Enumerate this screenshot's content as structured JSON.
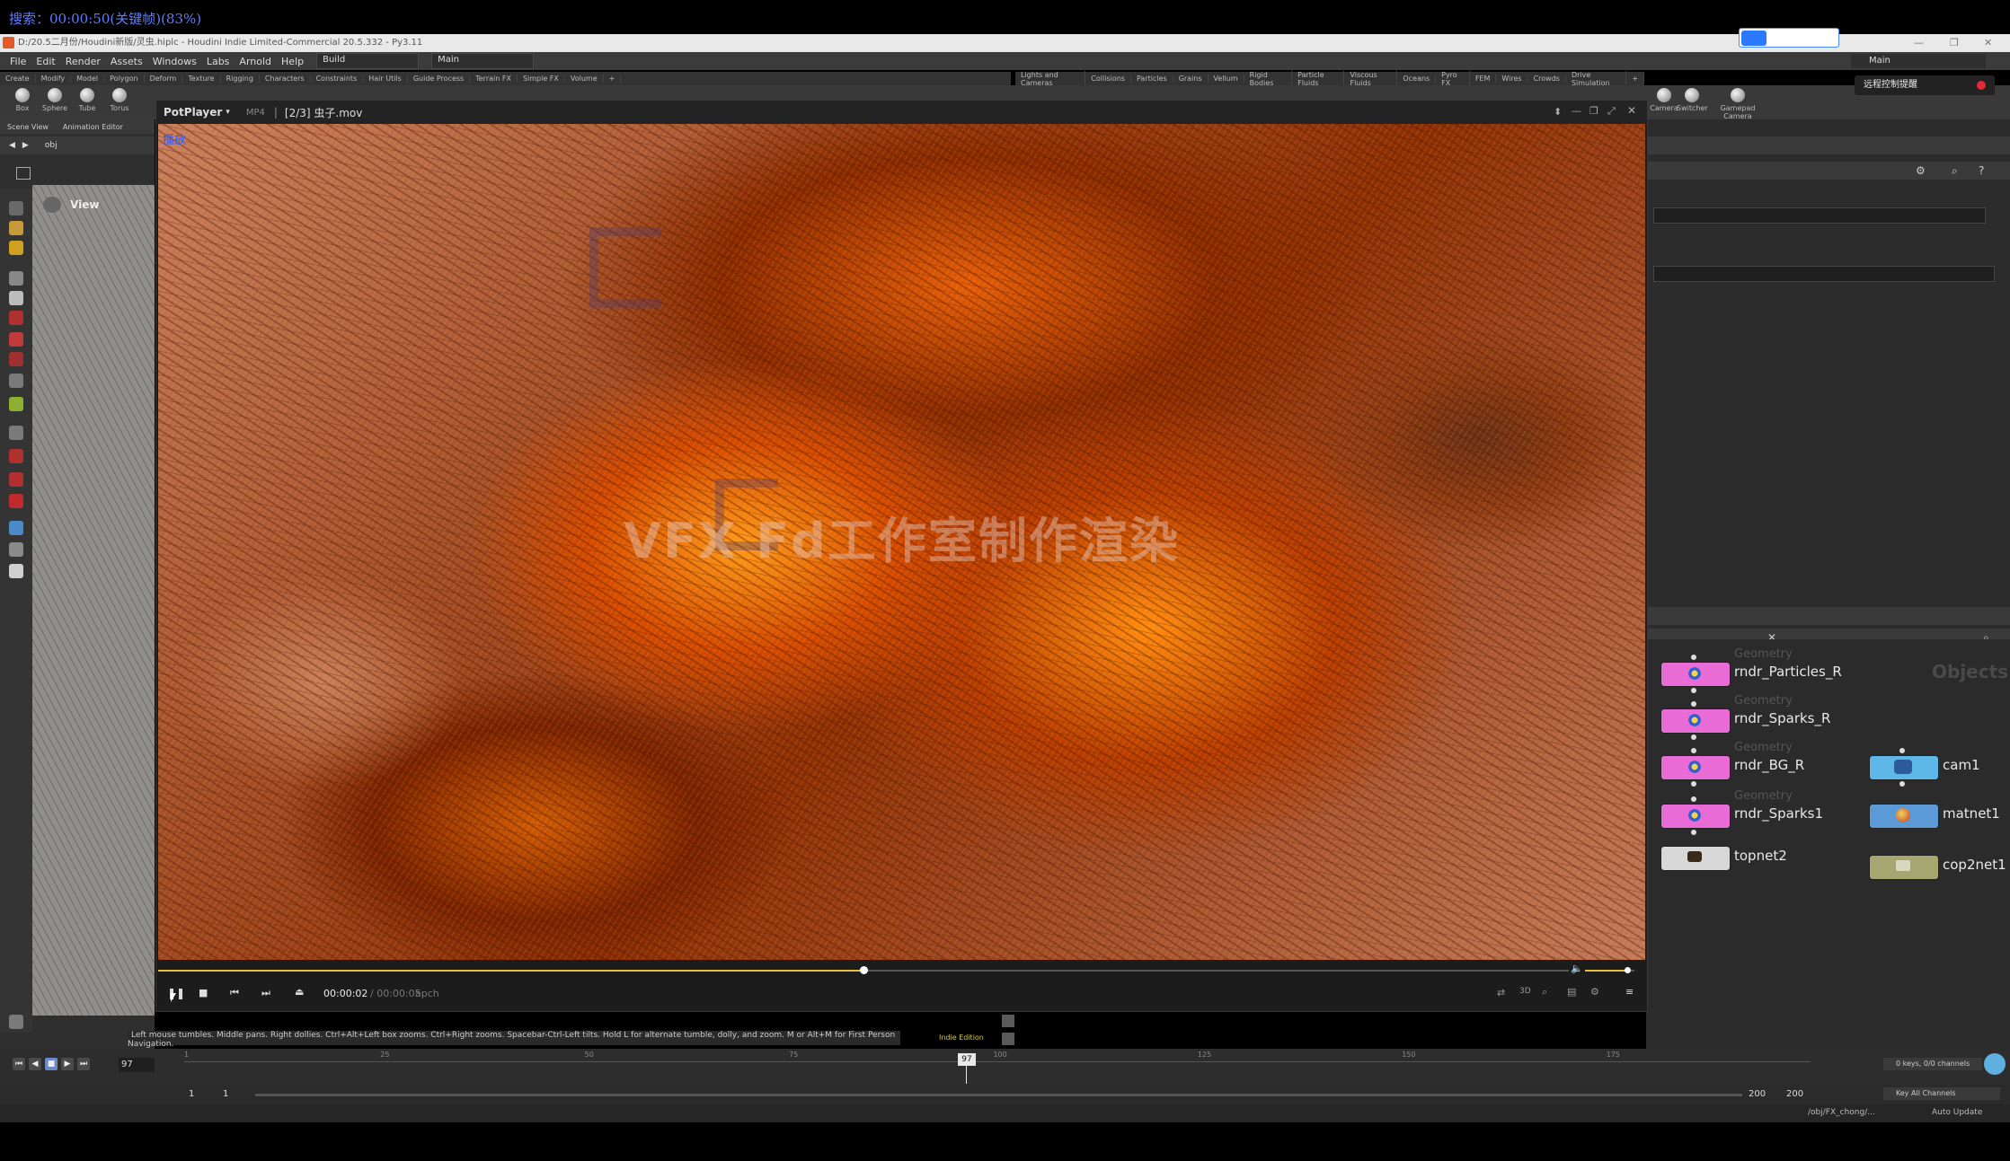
{
  "overlay": {
    "search_text": "搜索：00:00:50(关键帧)(83%)"
  },
  "houdini": {
    "title": "D:/20.5二月份/Houdini新版/灵虫.hiplc - Houdini Indie Limited-Commercial 20.5.332 - Py3.11",
    "menu": [
      "File",
      "Edit",
      "Render",
      "Assets",
      "Windows",
      "Labs",
      "Arnold",
      "Help"
    ],
    "build_dropdown": "Build",
    "main_dropdown": "Main",
    "main_dropdown_right": "Main",
    "remote_chip": "远程控制提醒",
    "shelf_tabs_left": [
      "Create",
      "Modify",
      "Model",
      "Polygon",
      "Deform",
      "Texture",
      "Rigging",
      "Characters",
      "Constraints",
      "Hair Utils",
      "Guide Process",
      "Terrain FX",
      "Simple FX",
      "Volume"
    ],
    "shelf_tabs_right": [
      "Lights and Cameras",
      "Collisions",
      "Particles",
      "Grains",
      "Vellum",
      "Rigid Bodies",
      "Particle Fluids",
      "Viscous Fluids",
      "Oceans",
      "Pyro FX",
      "FEM",
      "Wires",
      "Crowds",
      "Drive Simulation"
    ],
    "shelf_tools": [
      "Box",
      "Sphere",
      "Tube",
      "Torus"
    ],
    "shelf_tools_right": [
      "Camera",
      "Switcher",
      "Gamepad Camera"
    ],
    "left_tabs": [
      "Scene View",
      "Animation Editor"
    ],
    "left_path": "obj",
    "view_label": "View",
    "hint": "Left mouse tumbles. Middle pans. Right dollies. Ctrl+Alt+Left box zooms. Ctrl+Right zooms. Spacebar-Ctrl-Left tilts. Hold L for alternate tumble, dolly, and zoom. M or Alt+M for First Person Navigation.",
    "indie_label": "Indie Edition",
    "network_label": "Objects",
    "nodes": [
      {
        "type": "Geometry",
        "name": "rndr_Particles_R",
        "color": "#e86bd6"
      },
      {
        "type": "Geometry",
        "name": "rndr_Sparks_R",
        "color": "#e86bd6"
      },
      {
        "type": "Geometry",
        "name": "rndr_BG_R",
        "color": "#e86bd6"
      },
      {
        "type": "Geometry",
        "name": "rndr_Sparks1",
        "color": "#e86bd6"
      },
      {
        "type": "",
        "name": "topnet2",
        "color": "#d8d8d8"
      },
      {
        "type": "",
        "name": "cam1",
        "color": "#5db8e8"
      },
      {
        "type": "",
        "name": "matnet1",
        "color": "#5b9ad6"
      },
      {
        "type": "",
        "name": "cop2net1",
        "color": "#a6a670"
      }
    ],
    "timeline": {
      "current_frame": "97",
      "tick_labels": [
        "1",
        "25",
        "50",
        "75",
        "100",
        "125",
        "150",
        "175"
      ],
      "start": "1",
      "start2": "1",
      "end": "200",
      "end2": "200",
      "keys_label": "0 keys, 0/0 channels",
      "key_all": "Key All Channels",
      "status_path": "/obj/FX_chong/...",
      "auto_update": "Auto Update"
    }
  },
  "potplayer": {
    "app_name": "PotPlayer",
    "format": "MP4",
    "file_title": "[2/3] 虫子.mov",
    "play_tag": "播放",
    "watermark": "VFX Fd工作室制作渲染",
    "current_time": "00:00:02",
    "total_time": "/ 00:00:05",
    "codec": "apch",
    "progress": 0.5,
    "volume": 0.85
  }
}
